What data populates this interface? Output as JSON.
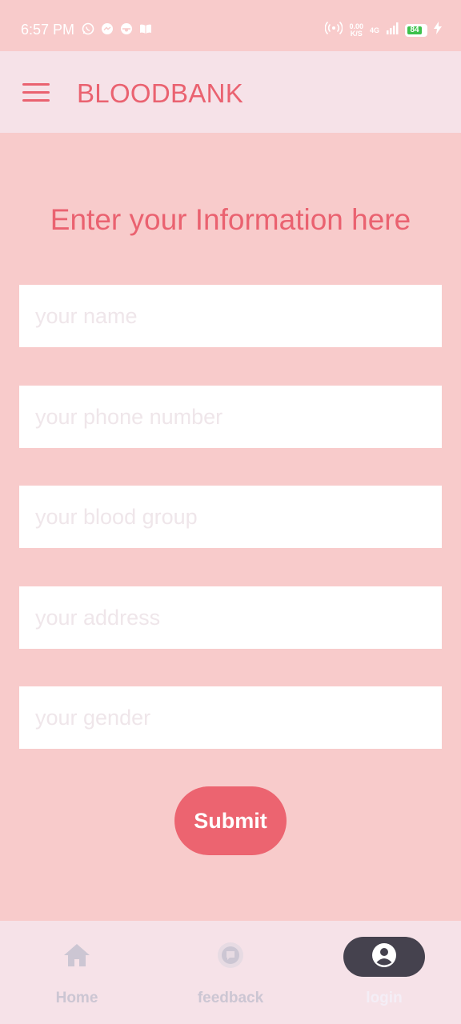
{
  "status_bar": {
    "time": "6:57 PM",
    "left_icons": [
      "whatsapp-icon",
      "messenger-icon",
      "app-icon",
      "book-icon"
    ],
    "speed_value": "0.00",
    "speed_unit": "K/S",
    "network": "4G",
    "battery": "84"
  },
  "app_bar": {
    "title": "BLOODBANK",
    "menu_icon": "hamburger-menu-icon"
  },
  "form": {
    "heading": "Enter your Information here",
    "fields": [
      {
        "placeholder": "your name",
        "value": ""
      },
      {
        "placeholder": "your phone number",
        "value": ""
      },
      {
        "placeholder": "your blood group",
        "value": ""
      },
      {
        "placeholder": "your address",
        "value": ""
      },
      {
        "placeholder": "your gender",
        "value": ""
      }
    ],
    "submit_label": "Submit"
  },
  "bottom_nav": {
    "items": [
      {
        "label": "Home",
        "icon": "home-icon",
        "active": false
      },
      {
        "label": "feedback",
        "icon": "feedback-icon",
        "active": false
      },
      {
        "label": "login",
        "icon": "account-icon",
        "active": true
      }
    ]
  },
  "colors": {
    "background": "#f8cbcb",
    "bar_background": "#f6e2e8",
    "accent": "#ea6270",
    "button": "#ec6470",
    "active_nav_pill": "#45424e",
    "battery_green": "#3cc14b"
  }
}
